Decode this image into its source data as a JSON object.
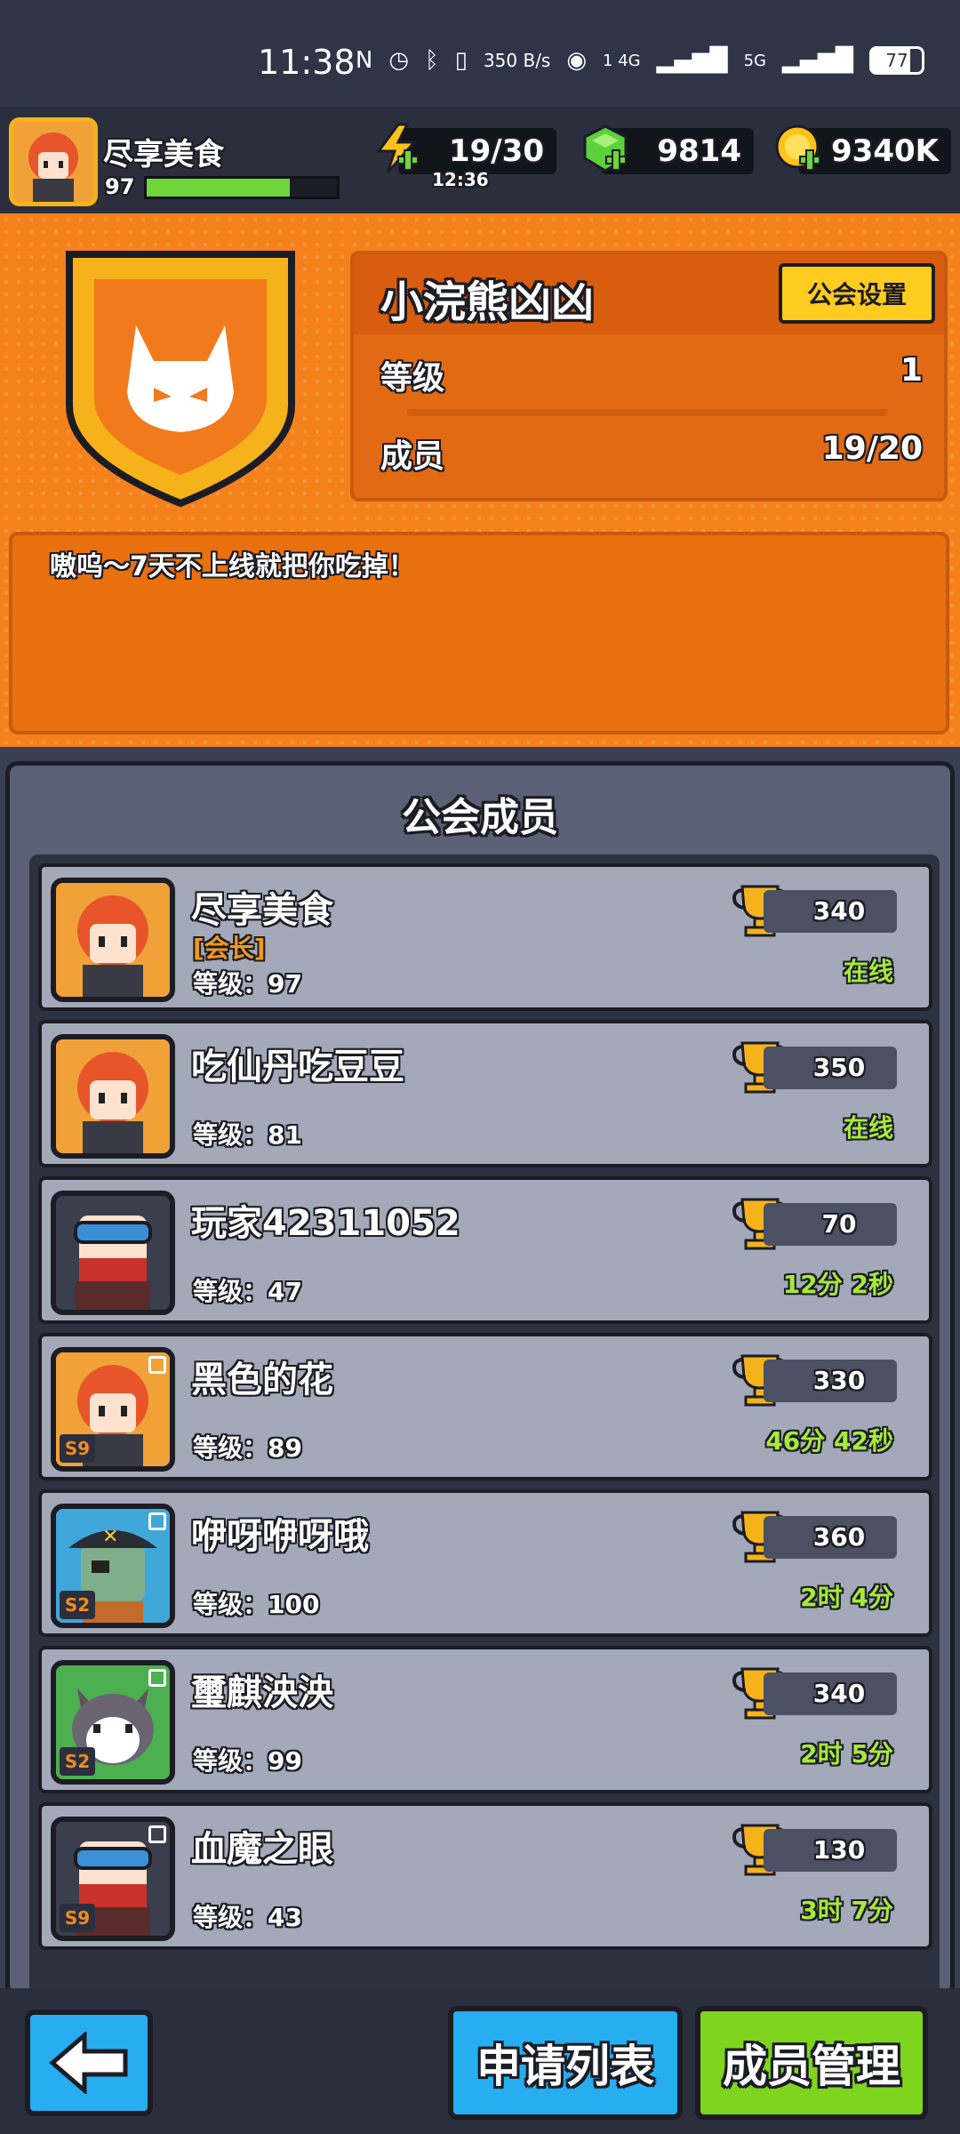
{
  "status_bar": {
    "time": "11:38",
    "net_speed": "350 B/s",
    "signal_label": "1 4G",
    "signal2_label": "5G",
    "battery": "77"
  },
  "player": {
    "name": "尽享美食",
    "level": "97",
    "xp_fraction": 0.75
  },
  "resources": {
    "energy": "19/30",
    "energy_timer": "12:36",
    "gems": "9814",
    "coins": "9340K"
  },
  "guild": {
    "name": "小浣熊凶凶",
    "settings_button": "公会设置",
    "level_label": "等级",
    "level_value": "1",
    "members_label": "成员",
    "members_value": "19/20",
    "description": "嗷呜～7天不上线就把你吃掉！"
  },
  "members_panel": {
    "title": "公会成员",
    "level_prefix": "等级：",
    "members": [
      {
        "name": "尽享美食",
        "title": "[会长]",
        "level": "97",
        "trophies": "340",
        "status": "在线",
        "avatar": "orange-hair-avatar",
        "season": ""
      },
      {
        "name": "吃仙丹吃豆豆",
        "title": "",
        "level": "81",
        "trophies": "350",
        "status": "在线",
        "avatar": "orange-hair-avatar",
        "season": ""
      },
      {
        "name": "玩家42311052",
        "title": "",
        "level": "47",
        "trophies": "70",
        "status": "12分 2秒",
        "avatar": "goggles-avatar",
        "season": ""
      },
      {
        "name": "黑色的花",
        "title": "",
        "level": "89",
        "trophies": "330",
        "status": "46分 42秒",
        "avatar": "orange-hair-avatar",
        "season": "S9"
      },
      {
        "name": "咿呀咿呀哦",
        "title": "",
        "level": "100",
        "trophies": "360",
        "status": "2时 4分",
        "avatar": "pirate-zombie-avatar",
        "season": "S2"
      },
      {
        "name": "璽麒泱泱",
        "title": "",
        "level": "99",
        "trophies": "340",
        "status": "2时 5分",
        "avatar": "cat-avatar",
        "season": "S2"
      },
      {
        "name": "血魔之眼",
        "title": "",
        "level": "43",
        "trophies": "130",
        "status": "3时 7分",
        "avatar": "goggles-avatar",
        "season": "S9"
      }
    ]
  },
  "bottom_bar": {
    "apply_list": "申请列表",
    "member_management": "成员管理"
  },
  "colors": {
    "orange_bg": "#f4811c",
    "online_green": "#a6ea3b",
    "gold": "#f5b21b",
    "blue_button": "#27aef0",
    "green_button": "#7fd41d"
  }
}
